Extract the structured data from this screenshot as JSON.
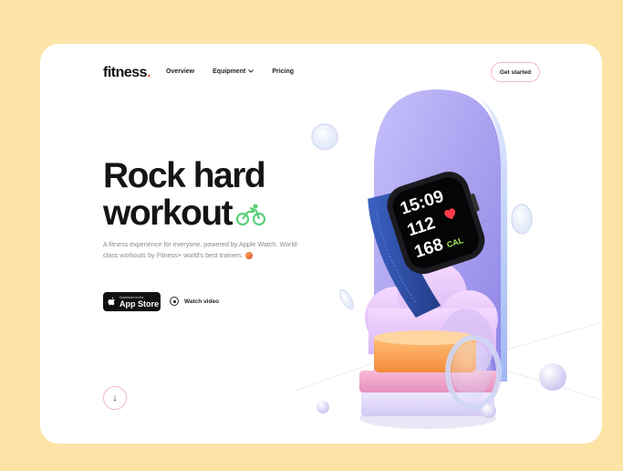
{
  "header": {
    "logo_text": "fitness",
    "logo_dot": ".",
    "nav": [
      {
        "label": "Overview"
      },
      {
        "label": "Equipment",
        "has_dropdown": true
      },
      {
        "label": "Pricing"
      }
    ],
    "cta_label": "Get started"
  },
  "hero": {
    "headline_line1": "Rock hard",
    "headline_line2": "workout",
    "description": "A fitness experience for everyone, powered by Apple Watch. World-class workouts by Fitness+ world's best trainers.",
    "appstore_small": "Download on the",
    "appstore_big": "App Store",
    "watch_video_label": "Watch video",
    "scroll_icon": "↓"
  },
  "watch_display": {
    "time": "15:09",
    "heart_value": "112",
    "calories_value": "168",
    "calories_unit": "CAL"
  },
  "colors": {
    "page_background": "#fde3a6",
    "card_background": "#ffffff",
    "accent_green": "#5ad07a",
    "accent_coral": "#f06a4a",
    "arch_purple": "#a89ef0",
    "watch_band_blue": "#2f4fa8",
    "podium_orange": "#f7a24c"
  }
}
